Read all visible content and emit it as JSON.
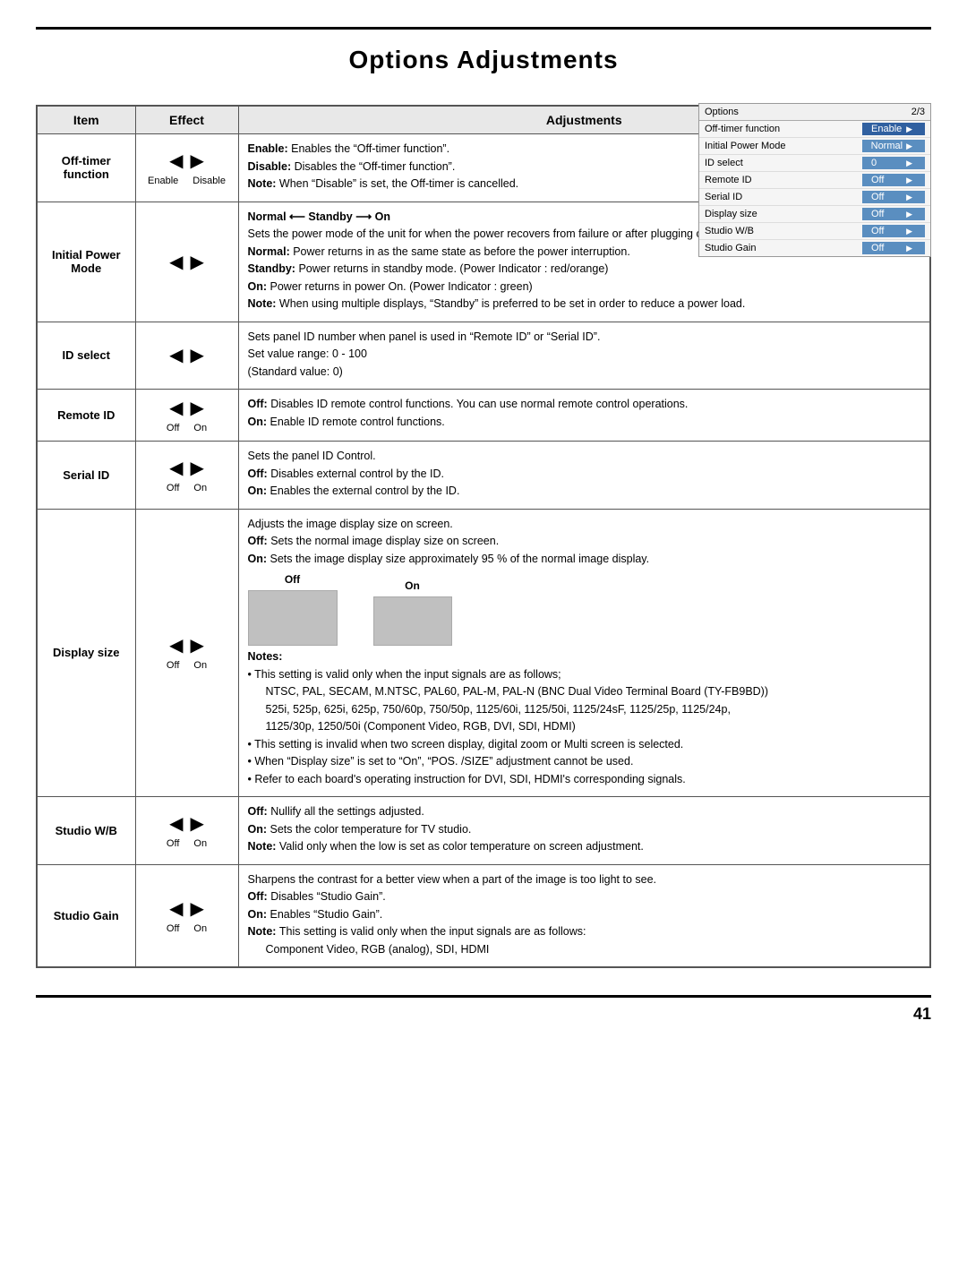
{
  "page": {
    "title": "Options Adjustments",
    "page_number": "41"
  },
  "menu": {
    "header_label": "Options",
    "header_page": "2/3",
    "rows": [
      {
        "label": "Off-timer function",
        "value": "Enable",
        "highlighted": true
      },
      {
        "label": "Initial Power Mode",
        "value": "Normal",
        "highlighted": false
      },
      {
        "label": "ID select",
        "value": "0",
        "highlighted": false
      },
      {
        "label": "Remote ID",
        "value": "Off",
        "highlighted": false
      },
      {
        "label": "Serial ID",
        "value": "Off",
        "highlighted": false
      },
      {
        "label": "Display size",
        "value": "Off",
        "highlighted": false
      },
      {
        "label": "Studio W/B",
        "value": "Off",
        "highlighted": false
      },
      {
        "label": "Studio Gain",
        "value": "Off",
        "highlighted": false
      }
    ]
  },
  "table": {
    "headers": [
      "Item",
      "Effect",
      "Adjustments"
    ],
    "rows": [
      {
        "item": "Off-timer function",
        "effect_labels": [
          "Enable",
          "Disable"
        ],
        "adjustments": [
          {
            "type": "label-text",
            "label": "Enable:",
            "text": "Enables the “Off-timer function”."
          },
          {
            "type": "label-text",
            "label": "Disable:",
            "text": "Disables the “Off-timer function”."
          },
          {
            "type": "label-text",
            "label": "Note:",
            "text": "When “Disable” is set, the Off-timer is cancelled."
          }
        ]
      },
      {
        "item": "Initial Power Mode",
        "effect_labels": [
          "",
          ""
        ],
        "adjustments": [
          {
            "type": "heading",
            "text": "Normal ⟵ Standby ⟶ On"
          },
          {
            "type": "plain",
            "text": "Sets the power mode of the unit for when the power recovers from failure or after plugging off and in again."
          },
          {
            "type": "label-text",
            "label": "Normal:",
            "text": "Power returns in as the same state as before the power interruption."
          },
          {
            "type": "label-text",
            "label": "Standby:",
            "text": "Power returns in standby mode. (Power Indicator : red/orange)"
          },
          {
            "type": "label-text",
            "label": "On:",
            "text": "Power returns in power On. (Power Indicator : green)"
          },
          {
            "type": "label-text",
            "label": "Note:",
            "text": "When using multiple displays, “Standby” is preferred to be set in order to reduce a power load."
          }
        ]
      },
      {
        "item": "ID select",
        "effect_labels": [
          "",
          ""
        ],
        "adjustments": [
          {
            "type": "plain",
            "text": "Sets panel ID number when panel is used in “Remote ID” or “Serial ID”."
          },
          {
            "type": "plain",
            "text": "Set value range: 0 - 100"
          },
          {
            "type": "plain",
            "text": "(Standard value: 0)"
          }
        ]
      },
      {
        "item": "Remote ID",
        "effect_labels": [
          "Off",
          "On"
        ],
        "adjustments": [
          {
            "type": "label-text",
            "label": "Off:",
            "text": "Disables ID remote control functions. You can use normal remote control operations."
          },
          {
            "type": "label-text",
            "label": "On:",
            "text": "Enable ID remote control functions."
          }
        ]
      },
      {
        "item": "Serial ID",
        "effect_labels": [
          "Off",
          "On"
        ],
        "adjustments": [
          {
            "type": "plain",
            "text": "Sets the panel ID Control."
          },
          {
            "type": "label-text",
            "label": "Off:",
            "text": "Disables external control by the ID."
          },
          {
            "type": "label-text",
            "label": "On:",
            "text": "Enables the external control by the ID."
          }
        ]
      },
      {
        "item": "Display size",
        "effect_labels": [
          "Off",
          "On"
        ],
        "adjustments": [
          {
            "type": "plain",
            "text": "Adjusts the image display size on screen."
          },
          {
            "type": "label-text",
            "label": "Off:",
            "text": "Sets the normal image display size on screen."
          },
          {
            "type": "label-text",
            "label": "On:",
            "text": "Sets the image display size approximately 95 % of the normal image display."
          },
          {
            "type": "display-images"
          },
          {
            "type": "notes-header",
            "text": "Notes:"
          },
          {
            "type": "bullet",
            "text": "This setting is valid only when the input signals are as follows;"
          },
          {
            "type": "plain-indent",
            "text": "NTSC, PAL, SECAM, M.NTSC, PAL60, PAL-M, PAL-N (BNC Dual Video Terminal Board (TY-FB9BD))"
          },
          {
            "type": "plain-indent",
            "text": "525i, 525p, 625i, 625p, 750/60p, 750/50p, 1125/60i, 1125/50i, 1125/24sF, 1125/25p, 1125/24p,"
          },
          {
            "type": "plain-indent",
            "text": "1125/30p, 1250/50i (Component Video, RGB, DVI, SDI, HDMI)"
          },
          {
            "type": "bullet",
            "text": "This setting is invalid when two screen display, digital zoom or Multi screen is selected."
          },
          {
            "type": "bullet",
            "text": "When “Display size” is set to “On”, “POS. /SIZE” adjustment cannot be used."
          },
          {
            "type": "bullet",
            "text": "Refer to each board's operating instruction for DVI, SDI, HDMI's corresponding signals."
          }
        ]
      },
      {
        "item": "Studio W/B",
        "effect_labels": [
          "Off",
          "On"
        ],
        "adjustments": [
          {
            "type": "label-text",
            "label": "Off:",
            "text": "Nullify all the settings adjusted."
          },
          {
            "type": "label-text",
            "label": "On:",
            "text": "Sets the color temperature for TV studio."
          },
          {
            "type": "label-text",
            "label": "Note:",
            "text": "Valid only when the low is set as color temperature on screen adjustment."
          }
        ]
      },
      {
        "item": "Studio Gain",
        "effect_labels": [
          "Off",
          "On"
        ],
        "adjustments": [
          {
            "type": "plain",
            "text": "Sharpens the contrast for a better view when a part of the image is too light to see."
          },
          {
            "type": "label-text",
            "label": "Off:",
            "text": "Disables “Studio Gain”."
          },
          {
            "type": "label-text",
            "label": "On:",
            "text": "Enables “Studio Gain”."
          },
          {
            "type": "label-text",
            "label": "Note:",
            "text": "This setting is valid only when the input signals are as follows:"
          },
          {
            "type": "plain-indent",
            "text": "Component Video, RGB (analog), SDI, HDMI"
          }
        ]
      }
    ]
  }
}
